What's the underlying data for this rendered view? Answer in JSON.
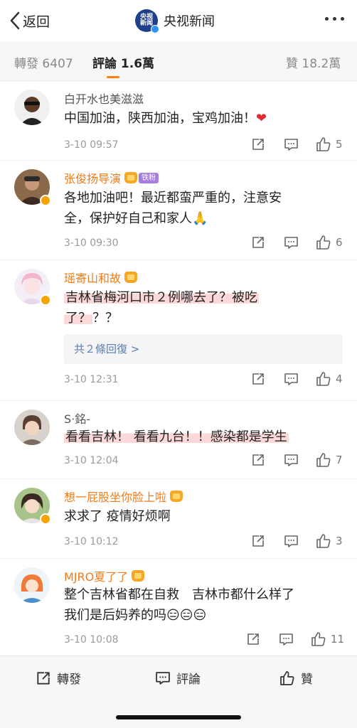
{
  "header": {
    "back_label": "返回",
    "account_name": "央视新闻",
    "logo_text": "央视新闻"
  },
  "tabs": [
    {
      "label": "轉發 6407"
    },
    {
      "label": "評論 1.6萬"
    },
    {
      "label": "贊 18.2萬"
    }
  ],
  "comments": [
    {
      "username": "白开水也美滋滋",
      "text": "中国加油，陕西加油，宝鸡加油！",
      "emoji": "❤",
      "time": "3-10 09:57",
      "likes": "5"
    },
    {
      "username": "张俊扬导演",
      "fan_badge": "铁粉",
      "text_line1": "各地加油吧！最近都蛮严重的，注意安",
      "text_line2": "全，保护好自己和家人",
      "emoji": "🙏",
      "time": "3-10 09:30",
      "likes": "6"
    },
    {
      "username": "瑶寄山和故",
      "text_line1": "吉林省梅河口市２例哪去了？被吃",
      "text_line2_hl": "了？",
      "text_line2_rest": "？？",
      "replies": "共２條回復 >",
      "time": "3-10 12:31",
      "likes": "4"
    },
    {
      "username": "S·銘-",
      "text": "看看吉林！ 看看九台！！感染都是学生",
      "time": "3-10 12:04",
      "likes": "7"
    },
    {
      "username": "想一屁股坐你脸上啦",
      "text": "求求了 疫情好烦啊",
      "time": "3-10 10:12",
      "likes": "3"
    },
    {
      "username": "MJRO夏了了",
      "text_line1": "整个吉林省都在自救　吉林市都什么样了",
      "text_line2": "我们是后妈养的吗",
      "emojis": "😑😑😑",
      "time": "3-10 10:08",
      "likes": "11"
    }
  ],
  "bottom_bar": {
    "repost": "轉發",
    "comment": "評論",
    "like": "贊"
  },
  "colors": {
    "accent": "#ff8200",
    "username_orange": "#f27c1a",
    "highlight": "#fcd9d8",
    "link_blue": "#5a7eb0"
  }
}
